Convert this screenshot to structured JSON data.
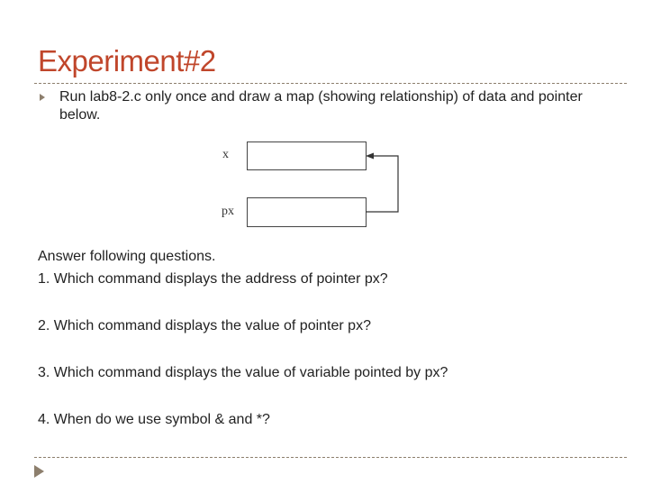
{
  "slide": {
    "title": "Experiment#2",
    "bullet": "Run lab8-2.c only once and draw a map (showing relationship) of data and pointer below.",
    "diagram": {
      "var_x_label": "x",
      "var_px_label": "px"
    },
    "intro": "Answer following questions.",
    "questions": [
      "1. Which command displays the address of pointer px?",
      "2. Which command displays the value of pointer px?",
      "3. Which command displays the value of variable pointed by px?",
      "4. When do we use symbol & and *?"
    ]
  },
  "colors": {
    "title": "#c0462b",
    "accent": "#8d7f6d"
  },
  "icons": {
    "bullet": "triangle-bullet-icon",
    "nav": "play-arrow-icon"
  }
}
